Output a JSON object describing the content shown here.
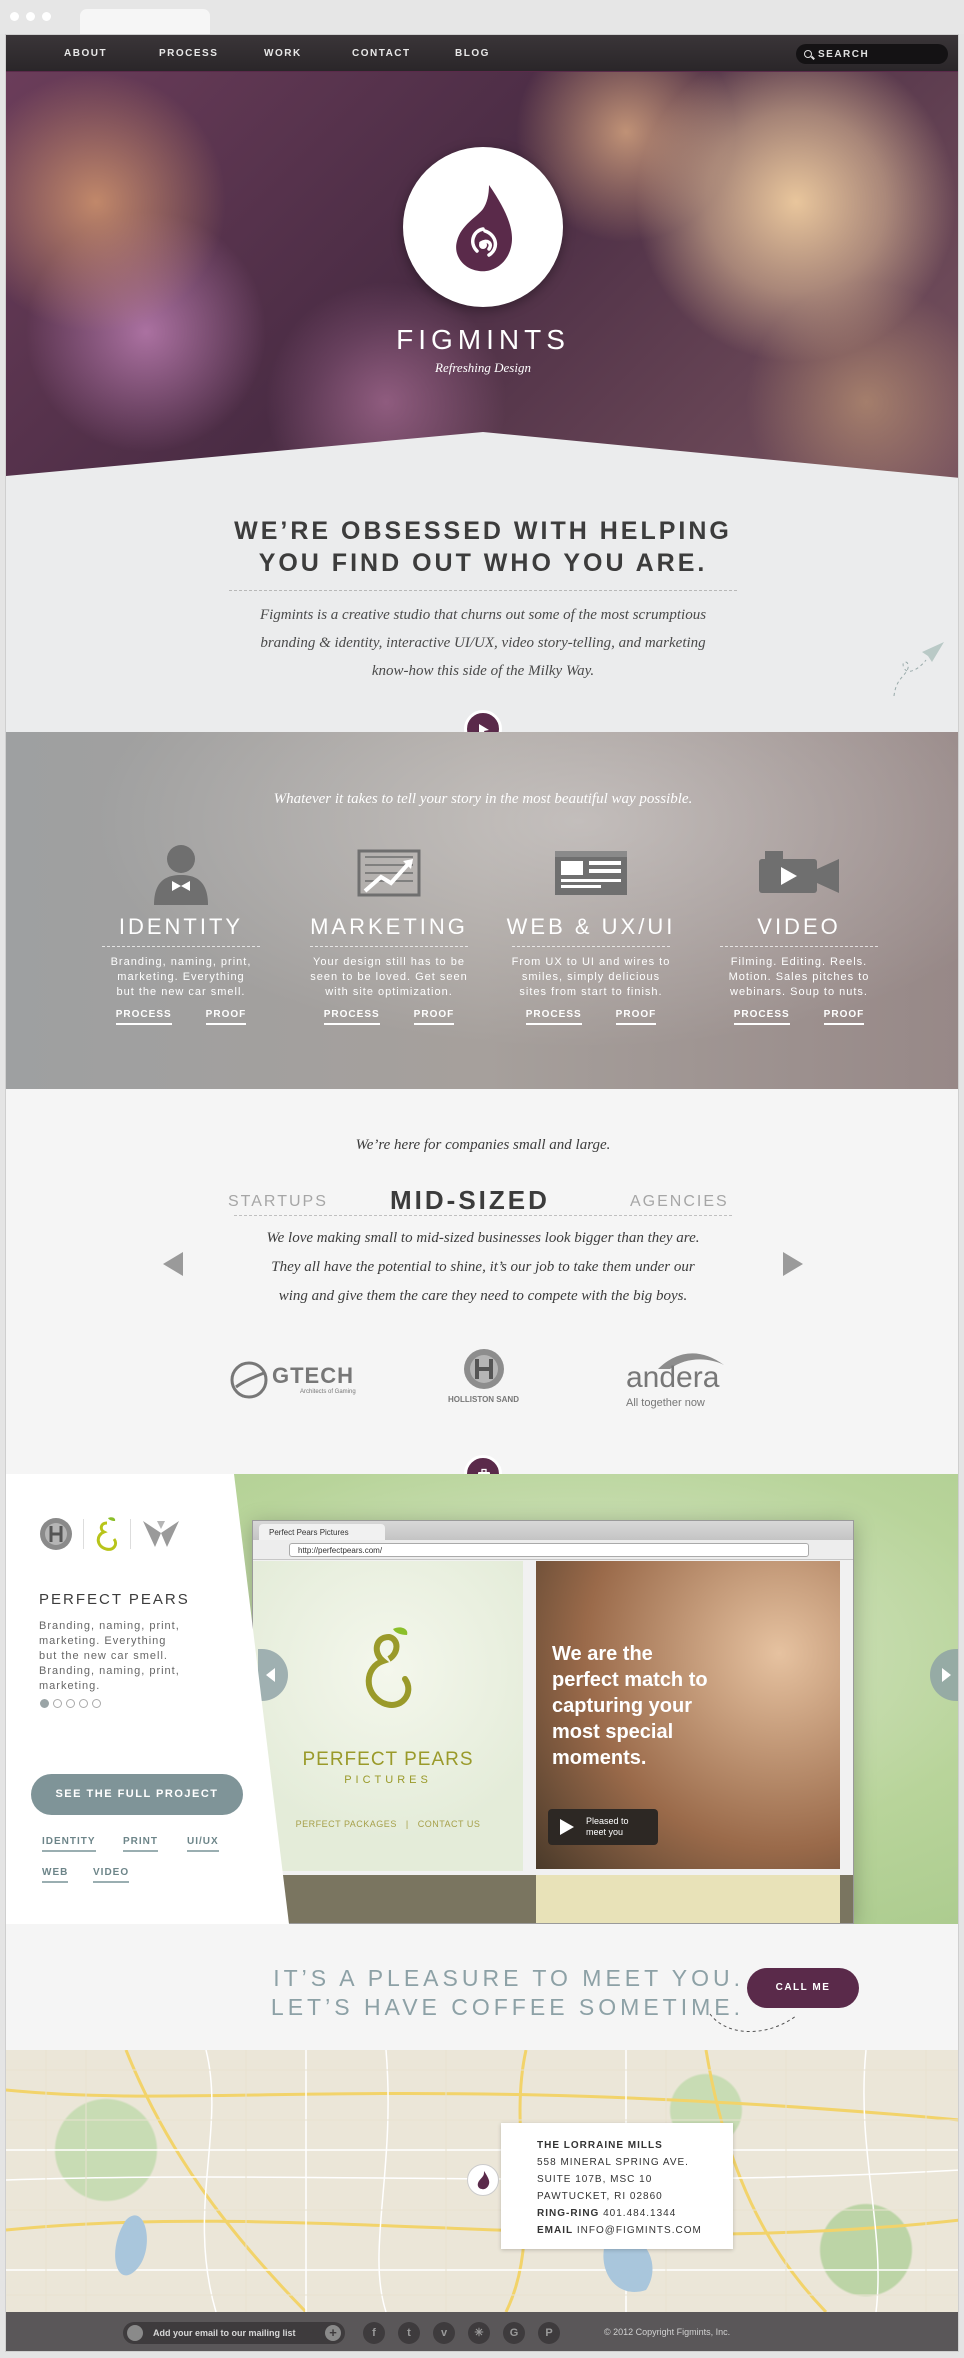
{
  "nav": {
    "items": [
      "ABOUT",
      "PROCESS",
      "WORK",
      "CONTACT",
      "BLOG"
    ],
    "search_label": "SEARCH"
  },
  "hero": {
    "brand": "FIGMINTS",
    "tagline": "Refreshing Design"
  },
  "intro": {
    "heading_line1": "WE’RE OBSESSED WITH HELPING",
    "heading_line2": "YOU FIND OUT WHO YOU ARE.",
    "body_line1": "Figmints is a creative studio that churns out some of the most scrumptious",
    "body_line2": "branding & identity, interactive UI/UX, video story-telling, and marketing",
    "body_line3": "know-how this side of the Milky Way."
  },
  "services": {
    "intro": "Whatever it takes to tell your story in the most beautiful way possible.",
    "link_process": "PROCESS",
    "link_proof": "PROOF",
    "items": [
      {
        "title": "IDENTITY",
        "desc1": "Branding, naming, print,",
        "desc2": "marketing. Everything",
        "desc3": "but the new car smell.",
        "icon": "person-bowtie-icon"
      },
      {
        "title": "MARKETING",
        "desc1": "Your design still has to be",
        "desc2": "seen to be loved. Get seen",
        "desc3": "with site optimization.",
        "icon": "chart-icon"
      },
      {
        "title": "WEB & UX/UI",
        "desc1": "From UX to UI and wires to",
        "desc2": "smiles, simply delicious",
        "desc3": "sites from start to finish.",
        "icon": "browser-icon"
      },
      {
        "title": "VIDEO",
        "desc1": "Filming. Editing. Reels.",
        "desc2": "Motion. Sales pitches to",
        "desc3": "webinars. Soup to nuts.",
        "icon": "camera-icon"
      }
    ]
  },
  "companies": {
    "intro": "We’re here for companies small and large.",
    "tabs": [
      "STARTUPS",
      "MID-SIZED",
      "AGENCIES"
    ],
    "body_line1": "We love making small to mid-sized businesses look bigger than they are.",
    "body_line2": "They all have the potential to shine, it’s our job to take them under our",
    "body_line3": "wing and give them the care they need to compete with the big boys.",
    "logos": {
      "gtech": "GTECH",
      "gtech_sub": "Architects of Gaming",
      "holliston": "HOLLISTON SAND",
      "andera": "andera",
      "andera_sub": "All together now"
    }
  },
  "portfolio": {
    "title": "PERFECT PEARS",
    "desc1": "Branding, naming, print,",
    "desc2": "marketing. Everything",
    "desc3": "but the new car smell.",
    "desc4": "Branding, naming, print,",
    "desc5": "marketing.",
    "button": "SEE THE FULL PROJECT",
    "tags": [
      "IDENTITY",
      "PRINT",
      "UI/UX",
      "WEB",
      "VIDEO"
    ],
    "slides_total": 5,
    "slide_active": 1,
    "browser": {
      "tab_title": "Perfect Pears Pictures",
      "url": "http://perfectpears.com/",
      "site_name": "PERFECT PEARS",
      "site_sub": "PICTURES",
      "link_packages": "PERFECT PACKAGES",
      "link_separator": "|",
      "link_contact": "CONTACT US",
      "photo_line1": "We are the",
      "photo_line2": "perfect match to",
      "photo_line3": "capturing your",
      "photo_line4": "most special",
      "photo_line5": "moments.",
      "play_line1": "Pleased to",
      "play_line2": "meet you"
    }
  },
  "cta": {
    "line1": "IT’S A PLEASURE TO MEET YOU.",
    "line2": "LET’S HAVE COFFEE SOMETIME.",
    "button": "CALL ME"
  },
  "map": {
    "place": "THE LORRAINE MILLS",
    "street": "558 MINERAL SPRING AVE.",
    "suite": "SUITE 107B, MSC 10",
    "city": "PAWTUCKET, RI 02860",
    "phone_label": "RING-RING",
    "phone": "401.484.1344",
    "email_label": "EMAIL",
    "email": "INFO@FIGMINTS.COM"
  },
  "footer": {
    "newsletter": "Add your email to our mailing list",
    "newsletter_plus": "+",
    "social_icons": [
      "facebook-icon",
      "twitter-icon",
      "vimeo-icon",
      "dribbble-icon",
      "google-icon",
      "pinterest-icon"
    ],
    "social_glyphs": [
      "f",
      "t",
      "v",
      "✳",
      "G",
      "P"
    ],
    "copyright": "© 2012 Copyright Figmints, Inc."
  },
  "colors": {
    "brand_plum": "#5a2a4a",
    "slate": "#7f9498",
    "pear_green": "#9a9a2a"
  }
}
